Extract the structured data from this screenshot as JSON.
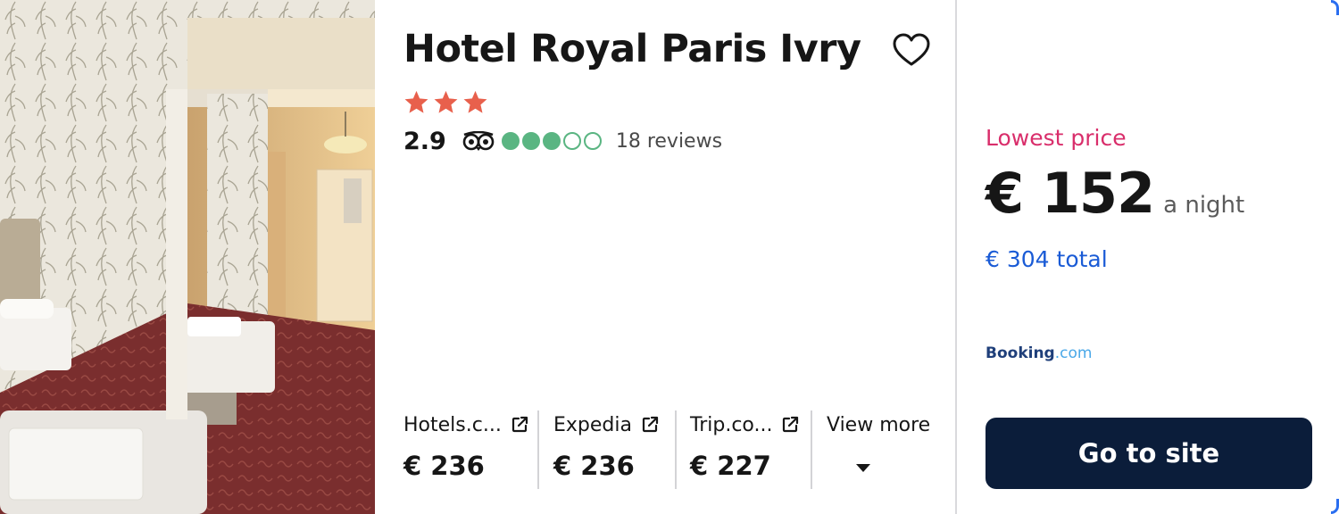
{
  "hotel": {
    "name": "Hotel Royal Paris Ivry",
    "star_count": 3,
    "rating_score": "2.9",
    "bubble_rating": 3,
    "bubble_max": 5,
    "review_count": "18 reviews"
  },
  "offers": [
    {
      "provider": "Hotels.c...",
      "price": "€ 236"
    },
    {
      "provider": "Expedia",
      "price": "€ 236"
    },
    {
      "provider": "Trip.co...",
      "price": "€ 227"
    }
  ],
  "view_more_label": "View more",
  "deal": {
    "label": "Lowest price",
    "price": "€ 152",
    "per": "a night",
    "total": "€ 304 total",
    "provider_name": "Booking",
    "provider_suffix": ".com",
    "cta": "Go to site"
  },
  "colors": {
    "star": "#e8604c",
    "bubble": "#5ab582",
    "lowest_label": "#d92e6b",
    "total": "#1a5bd6",
    "cta_bg": "#0b1d3a"
  },
  "icons": {
    "favorite": "heart-outline-icon",
    "rating_source": "tripadvisor-owl-icon",
    "external": "external-link-icon",
    "expand": "caret-down-icon"
  }
}
